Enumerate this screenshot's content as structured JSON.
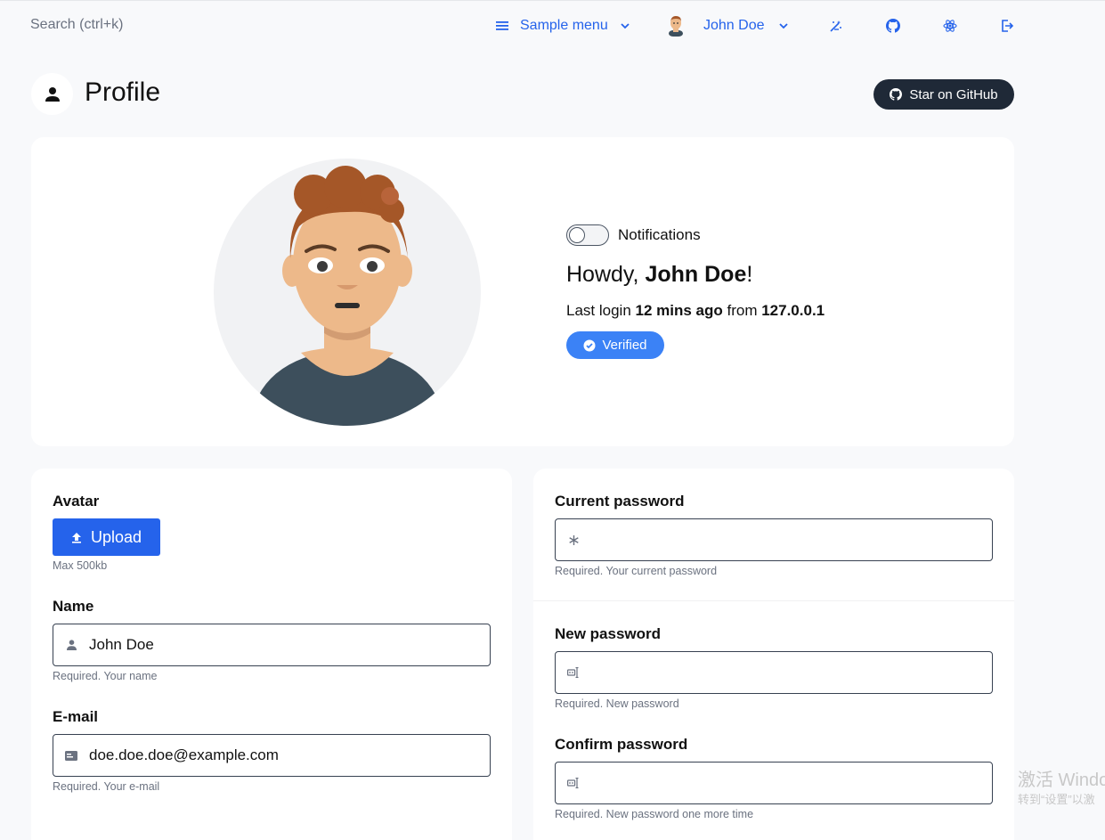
{
  "topbar": {
    "search_placeholder": "Search (ctrl+k)",
    "menu_label": "Sample menu",
    "user_name": "John Doe"
  },
  "page": {
    "title": "Profile",
    "github_button": "Star on GitHub"
  },
  "profile": {
    "notifications_label": "Notifications",
    "notifications_on": false,
    "greeting_prefix": "Howdy, ",
    "name": "John Doe",
    "greeting_suffix": "!",
    "last_login_prefix": "Last login ",
    "last_login_time": "12 mins ago",
    "last_login_from": " from ",
    "last_login_ip": "127.0.0.1",
    "verified_label": "Verified"
  },
  "profile_form": {
    "avatar_label": "Avatar",
    "upload_label": "Upload",
    "avatar_help": "Max 500kb",
    "name_label": "Name",
    "name_value": "John Doe",
    "name_help": "Required. Your name",
    "email_label": "E-mail",
    "email_value": "doe.doe.doe@example.com",
    "email_help": "Required. Your e-mail"
  },
  "password_form": {
    "current_label": "Current password",
    "current_help": "Required. Your current password",
    "new_label": "New password",
    "new_help": "Required. New password",
    "confirm_label": "Confirm password",
    "confirm_help": "Required. New password one more time"
  },
  "watermark": {
    "line1": "激活 Windo",
    "line2": "转到“设置”以激"
  },
  "colors": {
    "accent": "#2563eb",
    "verified": "#3b82f6",
    "dark_button": "#1f2937"
  }
}
